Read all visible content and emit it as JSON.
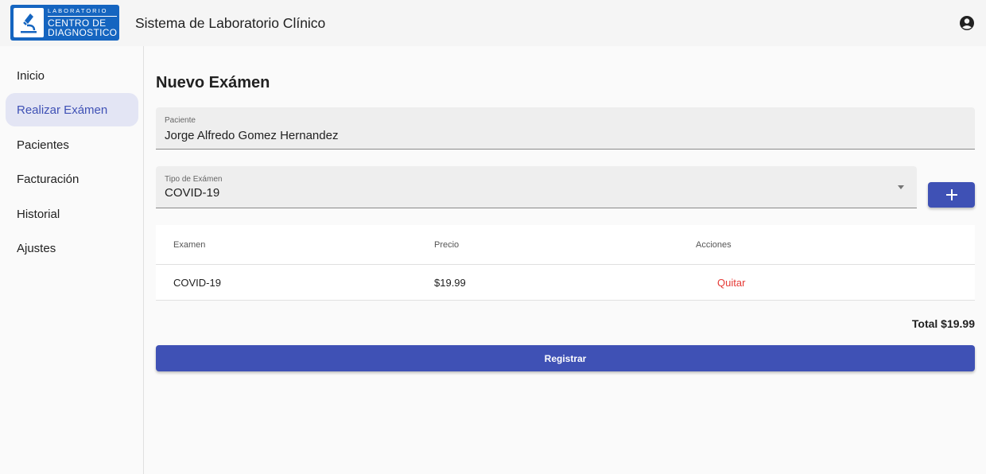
{
  "header": {
    "logo": {
      "line1": "LABORATORIO",
      "line2": "CENTRO DE",
      "line3": "DIAGNOSTICO"
    },
    "title": "Sistema de Laboratorio Clínico",
    "account_icon": "account-circle-icon"
  },
  "sidebar": {
    "items": [
      {
        "label": "Inicio",
        "active": false
      },
      {
        "label": "Realizar Exámen",
        "active": true
      },
      {
        "label": "Pacientes",
        "active": false
      },
      {
        "label": "Facturación",
        "active": false
      },
      {
        "label": "Historial",
        "active": false
      },
      {
        "label": "Ajustes",
        "active": false
      }
    ]
  },
  "main": {
    "title": "Nuevo Exámen",
    "patient_field": {
      "label": "Paciente",
      "value": "Jorge Alfredo Gomez Hernandez"
    },
    "exam_type_field": {
      "label": "Tipo de Exámen",
      "value": "COVID-19"
    },
    "add_button_icon": "plus-icon",
    "table": {
      "columns": [
        "Examen",
        "Precio",
        "Acciones"
      ],
      "rows": [
        {
          "exam": "COVID-19",
          "price": "$19.99",
          "action": "Quitar"
        }
      ]
    },
    "total": "Total $19.99",
    "submit_label": "Registrar"
  },
  "colors": {
    "primary": "#3f51b5",
    "logo_blue": "#1565c0",
    "danger": "#e53935",
    "active_nav_bg": "#e3e5f4"
  }
}
